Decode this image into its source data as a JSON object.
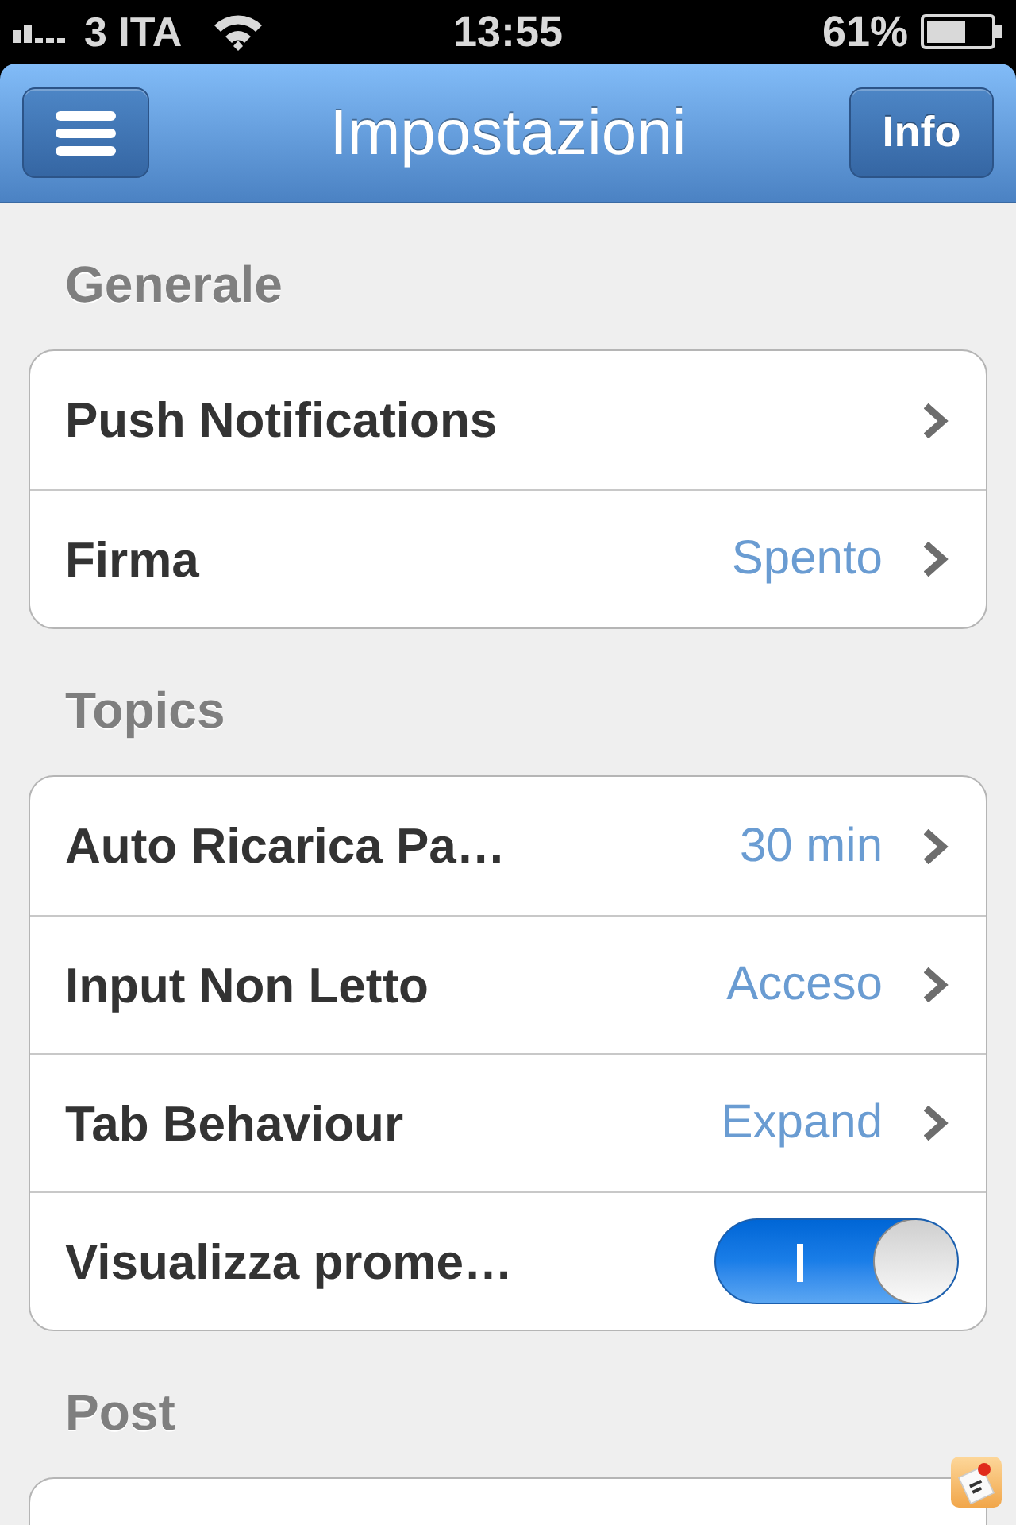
{
  "status_bar": {
    "carrier": "3 ITA",
    "time": "13:55",
    "battery": "61%"
  },
  "nav_bar": {
    "title": "Impostazioni",
    "info_button": "Info"
  },
  "sections": [
    {
      "header": "Generale",
      "rows": [
        {
          "kind": "link",
          "label": "Push Notifications"
        },
        {
          "kind": "link",
          "label": "Firma",
          "value": "Spento"
        }
      ]
    },
    {
      "header": "Topics",
      "rows": [
        {
          "kind": "link",
          "label": "Auto Ricarica Pa…",
          "value": "30 min"
        },
        {
          "kind": "link",
          "label": "Input Non Letto",
          "value": "Acceso"
        },
        {
          "kind": "link",
          "label": "Tab Behaviour",
          "value": "Expand"
        },
        {
          "kind": "toggle",
          "label": "Visualizza prome…",
          "on": true
        }
      ]
    },
    {
      "header": "Post"
    }
  ]
}
